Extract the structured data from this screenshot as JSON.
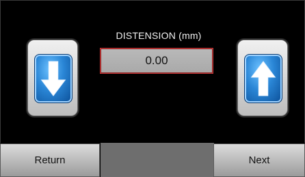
{
  "distension": {
    "label": "DISTENSION (mm)",
    "value": "0.00"
  },
  "controls": {
    "decrease_icon": "arrow-down",
    "increase_icon": "arrow-up"
  },
  "footer": {
    "return_label": "Return",
    "next_label": "Next"
  },
  "colors": {
    "background": "#000000",
    "readout_border": "#c43a3a",
    "arrow_blue": "#2a86d6"
  }
}
